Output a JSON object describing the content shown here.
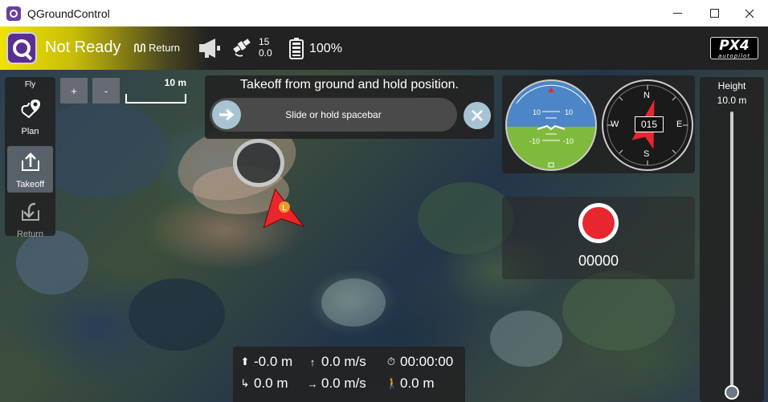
{
  "window": {
    "title": "QGroundControl",
    "controls": {
      "minimize": "—",
      "maximize": "☐",
      "close": "✕"
    }
  },
  "toolbar": {
    "status": "Not Ready",
    "flight_mode": "Return",
    "gps_satellites": "15",
    "gps_hdop": "0.0",
    "battery": "100%",
    "brand_logo": "PX4",
    "brand_sub": "autopilot",
    "status_color": "#f1e300"
  },
  "toolstrip": {
    "title": "Fly",
    "items": [
      {
        "label": "Plan",
        "icon": "plan-icon"
      },
      {
        "label": "Takeoff",
        "icon": "takeoff-icon",
        "active": true
      },
      {
        "label": "Return",
        "icon": "return-icon",
        "disabled": true
      }
    ]
  },
  "map": {
    "zoom_in": "+",
    "zoom_out": "-",
    "scale_label": "10 m",
    "vehicle_marker_label": "L"
  },
  "action": {
    "title": "Takeoff from ground and hold position.",
    "slider_text": "Slide or hold spacebar",
    "cancel_icon": "close-icon"
  },
  "instruments": {
    "pitch_up_left": "10",
    "pitch_up_right": "10",
    "pitch_down_left": "-10",
    "pitch_down_right": "-10",
    "compass": {
      "n": "N",
      "e": "E",
      "s": "S",
      "w": "W"
    },
    "heading": "015"
  },
  "camera": {
    "record_count": "00000",
    "record_color": "#e82630"
  },
  "height_slider": {
    "title": "Height",
    "value": "10.0 m",
    "level": 0.0
  },
  "telemetry": {
    "altitude": "-0.0 m",
    "vertical_speed": "0.0 m/s",
    "flight_time": "00:00:00",
    "distance_home": "0.0 m",
    "horizontal_speed": "0.0 m/s",
    "distance_walk": "0.0 m"
  }
}
